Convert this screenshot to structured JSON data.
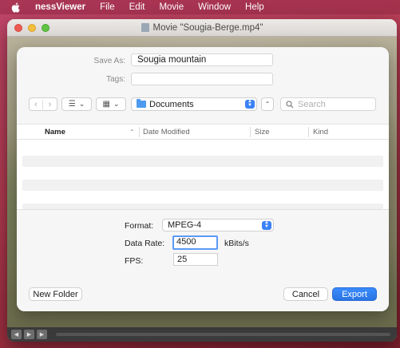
{
  "menubar": {
    "app_name": "nessViewer",
    "items": [
      "File",
      "Edit",
      "Movie",
      "Window",
      "Help"
    ]
  },
  "movie_window": {
    "title": "Movie \"Sougia-Berge.mp4\""
  },
  "sheet": {
    "save_as_label": "Save As:",
    "save_as_value": "Sougia mountain",
    "tags_label": "Tags:",
    "tags_value": "",
    "location": "Documents",
    "search_placeholder": "Search",
    "columns": {
      "name": "Name",
      "date_modified": "Date Modified",
      "size": "Size",
      "kind": "Kind"
    },
    "format_label": "Format:",
    "format_value": "MPEG-4",
    "data_rate_label": "Data Rate:",
    "data_rate_value": "4500",
    "data_rate_unit": "kBits/s",
    "fps_label": "FPS:",
    "fps_value": "25",
    "new_folder_label": "New Folder",
    "cancel_label": "Cancel",
    "export_label": "Export"
  },
  "colors": {
    "accent": "#2a74e3",
    "folder": "#4d9bf0",
    "desktop": "#b23a4f"
  },
  "icons": [
    "apple-icon",
    "back-icon",
    "forward-icon",
    "list-view-icon",
    "grid-view-icon",
    "folder-icon",
    "expand-icon",
    "search-icon",
    "sort-ascending-icon"
  ]
}
